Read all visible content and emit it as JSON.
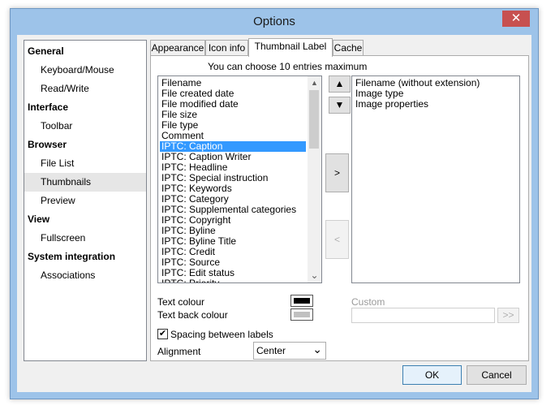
{
  "window": {
    "title": "Options",
    "close_glyph": "✕"
  },
  "sidebar": {
    "items": [
      {
        "label": "General",
        "kind": "category"
      },
      {
        "label": "Keyboard/Mouse",
        "kind": "item"
      },
      {
        "label": "Read/Write",
        "kind": "item"
      },
      {
        "label": "Interface",
        "kind": "category"
      },
      {
        "label": "Toolbar",
        "kind": "item"
      },
      {
        "label": "Browser",
        "kind": "category"
      },
      {
        "label": "File List",
        "kind": "item"
      },
      {
        "label": "Thumbnails",
        "kind": "item",
        "selected": true
      },
      {
        "label": "Preview",
        "kind": "item"
      },
      {
        "label": "View",
        "kind": "category"
      },
      {
        "label": "Fullscreen",
        "kind": "item"
      },
      {
        "label": "System integration",
        "kind": "category"
      },
      {
        "label": "Associations",
        "kind": "item"
      }
    ]
  },
  "tabs": [
    {
      "label": "Appearance"
    },
    {
      "label": "Icon info"
    },
    {
      "label": "Thumbnail Label",
      "active": true
    },
    {
      "label": "Cache"
    }
  ],
  "panel": {
    "hint": "You can choose 10 entries maximum",
    "available_list": [
      "Filename",
      "File created date",
      "File modified date",
      "File size",
      "File type",
      "Comment",
      "IPTC: Caption",
      "IPTC: Caption Writer",
      "IPTC: Headline",
      "IPTC: Special instruction",
      "IPTC: Keywords",
      "IPTC: Category",
      "IPTC: Supplemental categories",
      "IPTC: Copyright",
      "IPTC: Byline",
      "IPTC: Byline Title",
      "IPTC: Credit",
      "IPTC: Source",
      "IPTC: Edit status",
      "IPTC: Priority"
    ],
    "available_selected": "IPTC: Caption",
    "selected_list": [
      "Filename (without extension)",
      "Image type",
      "Image properties"
    ],
    "move_up_glyph": "▲",
    "move_down_glyph": "▼",
    "add_label": ">",
    "remove_label": "<",
    "text_colour_label": "Text colour",
    "text_colour": "#000000",
    "text_back_colour_label": "Text back colour",
    "text_back_colour": "#c0c0c0",
    "custom_label": "Custom",
    "custom_value": "",
    "custom_add_label": ">>",
    "spacing_label": "Spacing between labels",
    "spacing_checked": true,
    "check_glyph": "✔",
    "alignment_label": "Alignment",
    "alignment_value": "Center",
    "combo_arrow": "⌄"
  },
  "footer": {
    "ok_label": "OK",
    "cancel_label": "Cancel"
  },
  "scroll": {
    "up_glyph": "▲",
    "down_glyph": "⌄"
  },
  "colors": {
    "selection": "#3399ff",
    "titlebar": "#9dc3e9",
    "close": "#c75050"
  }
}
